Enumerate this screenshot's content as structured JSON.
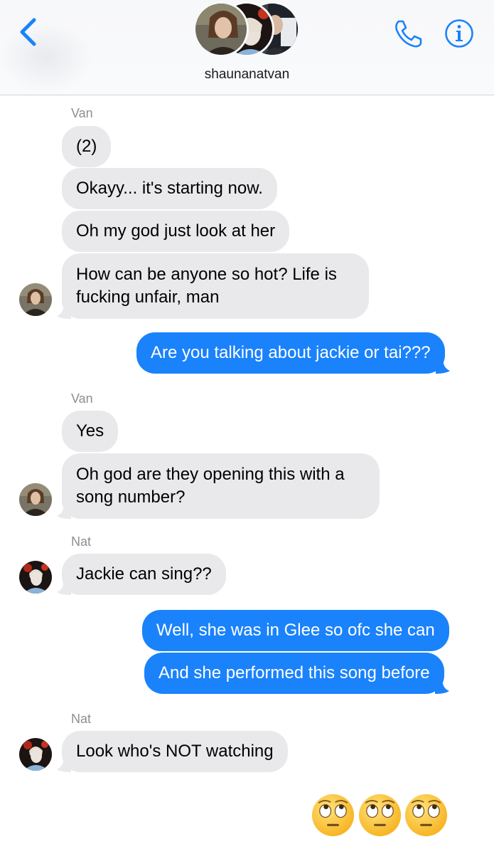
{
  "header": {
    "title": "shaunanatvan",
    "back_icon": "chevron-left-icon",
    "call_icon": "phone-icon",
    "info_icon": "info-icon",
    "accent_color": "#1a82fb"
  },
  "messages": [
    {
      "sender": "Van",
      "direction": "incoming",
      "texts": [
        "(2)",
        "Okayy... it's starting now.",
        "Oh my god just look at her",
        "How can be anyone so hot? Life is fucking unfair, man"
      ]
    },
    {
      "sender": "",
      "direction": "outgoing",
      "texts": [
        "Are you talking about jackie or tai???"
      ]
    },
    {
      "sender": "Van",
      "direction": "incoming",
      "texts": [
        "Yes",
        "Oh god are they opening this with a song number?"
      ]
    },
    {
      "sender": "Nat",
      "direction": "incoming",
      "texts": [
        "Jackie can sing??"
      ]
    },
    {
      "sender": "",
      "direction": "outgoing",
      "texts": [
        "Well, she was in Glee so ofc she can",
        "And she performed this song before"
      ]
    },
    {
      "sender": "Nat",
      "direction": "incoming",
      "texts": [
        "Look who's NOT watching"
      ]
    },
    {
      "sender": "",
      "direction": "outgoing",
      "texts": [
        "🙄🙄🙄"
      ],
      "emoji_name": "eye-roll-emoji"
    }
  ],
  "colors": {
    "incoming_bubble": "#e9e9eb",
    "outgoing_bubble": "#1a82fb",
    "sender_label": "#8e8e93"
  }
}
